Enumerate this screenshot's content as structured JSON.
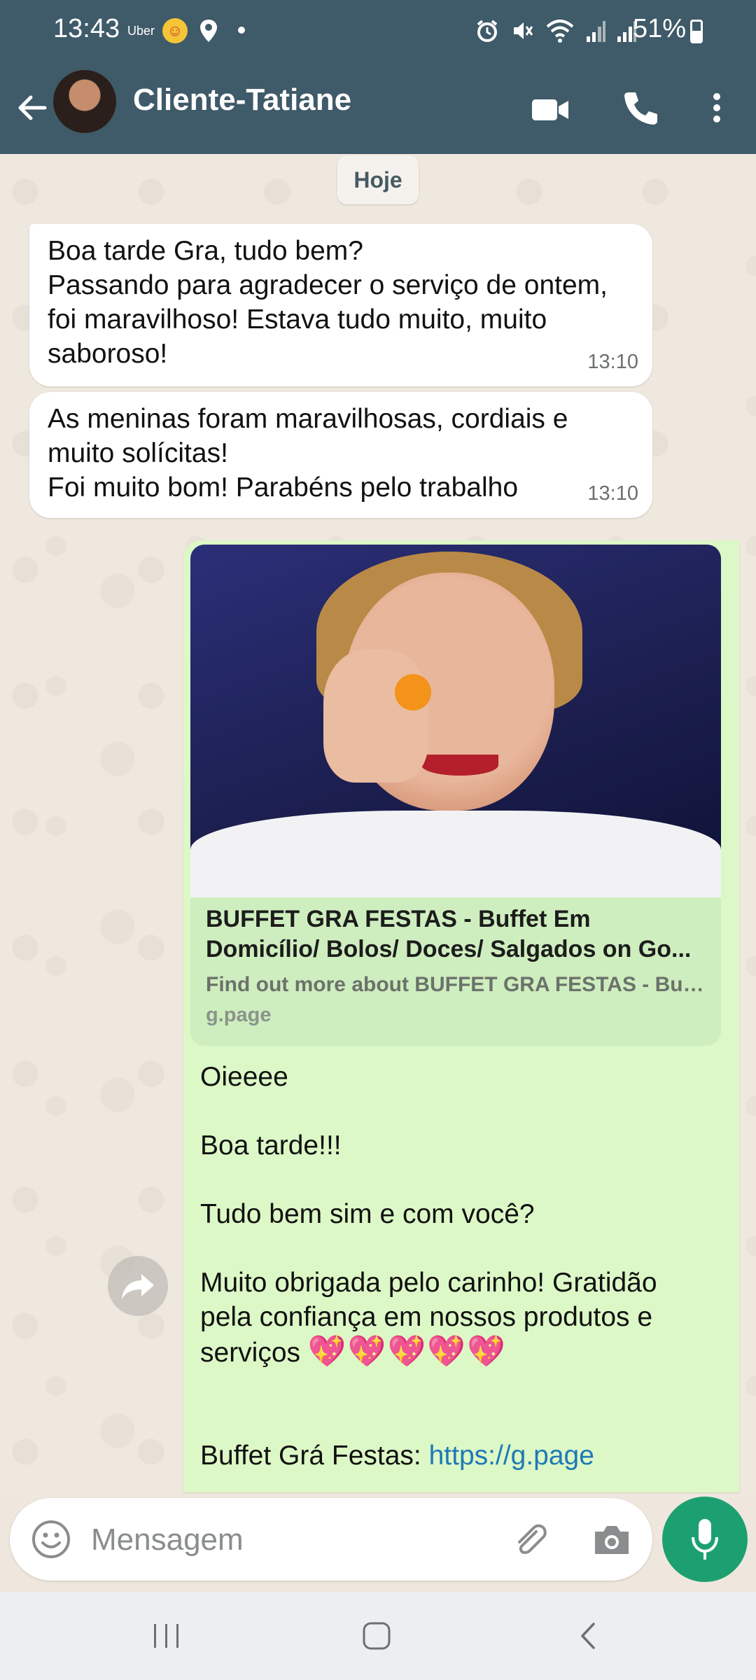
{
  "status_bar": {
    "time": "13:43",
    "uber_label": "Uber",
    "battery": "51%"
  },
  "header": {
    "contact_name": "Cliente-Tatiane"
  },
  "date_chip": "Hoje",
  "messages_in": [
    {
      "text": "Boa tarde Gra, tudo bem?\nPassando para agradecer o serviço de ontem, foi maravilhoso! Estava tudo muito, muito saboroso!",
      "time": "13:10"
    },
    {
      "text": "As meninas foram maravilhosas, cordiais e muito solícitas!\nFoi muito bom! Parabéns pelo trabalho",
      "time": "13:10"
    }
  ],
  "message_out": {
    "link_preview": {
      "title": "BUFFET GRA FESTAS - Buffet Em Domicílio/ Bolos/ Doces/ Salgados on Go...",
      "description": "Find out more about BUFFET GRA FESTAS - Buf...",
      "domain": "g.page"
    },
    "line_1": "Oieeee",
    "line_2": "Boa tarde!!!",
    "line_3": "Tudo bem sim e com você?",
    "line_4": "Muito obrigada pelo carinho! Gratidão pela confiança em nossos produtos e serviços",
    "hearts": "💖💖💖💖💖",
    "signature_prefix": "Buffet Grá Festas: ",
    "signature_link": "https://g.page"
  },
  "composer": {
    "placeholder": "Mensagem"
  },
  "colors": {
    "header": "#3f5a68",
    "bubble_out": "#dcf8c6",
    "bubble_in": "#ffffff",
    "mic_button": "#1da071",
    "link": "#1f79b6"
  }
}
